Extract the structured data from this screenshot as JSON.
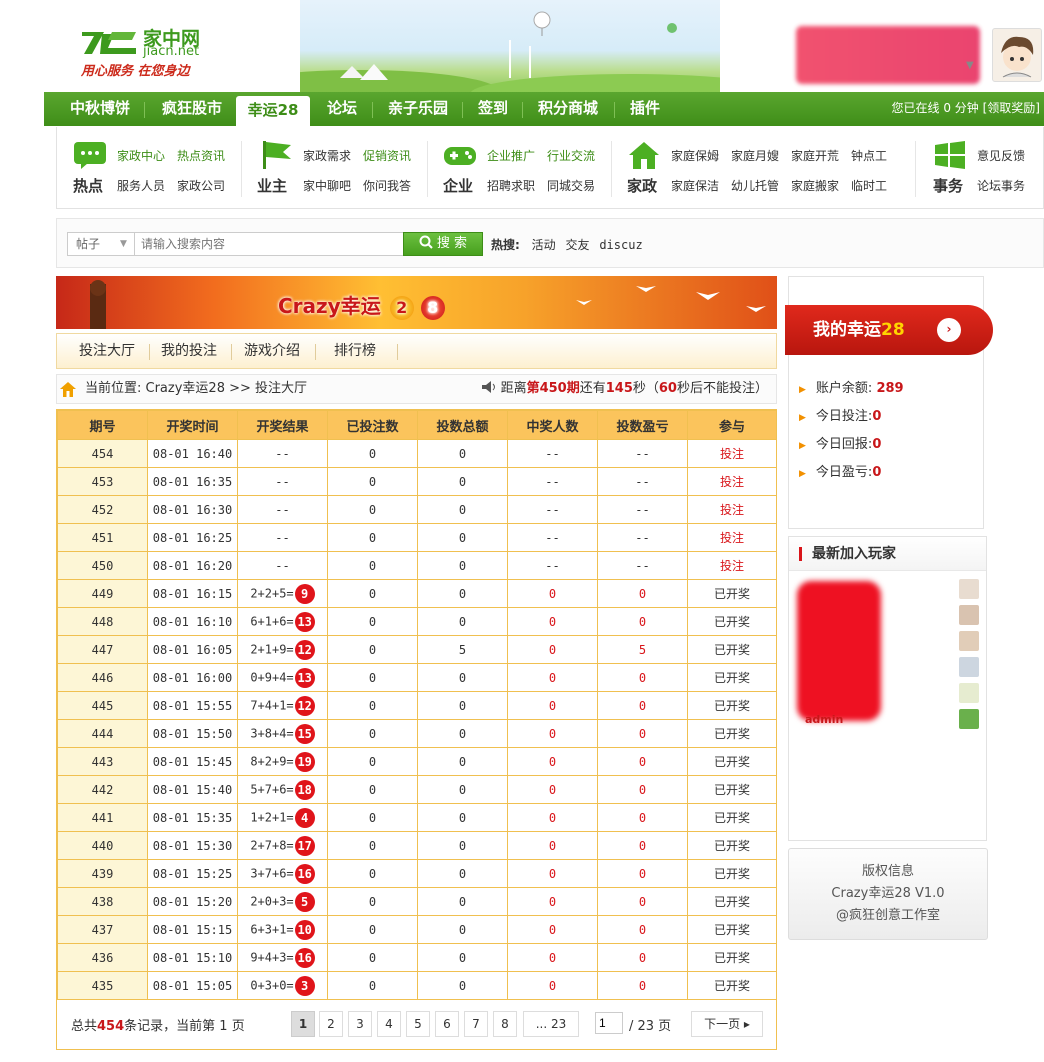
{
  "header": {
    "logo_name": "家中网",
    "logo_domain": "jiacn.net",
    "logo_slogan": "用心服务  在您身边"
  },
  "nav": {
    "items": [
      "中秋博饼",
      "疯狂股市",
      "幸运28",
      "论坛",
      "亲子乐园",
      "签到",
      "积分商城",
      "插件"
    ],
    "active": "幸运28",
    "online_text": "您已在线 0 分钟 [领取奖励]"
  },
  "categories": [
    {
      "title": "热点",
      "links": [
        "家政中心",
        "热点资讯",
        "服务人员",
        "家政公司"
      ]
    },
    {
      "title": "业主",
      "links": [
        "家政需求",
        "促销资讯",
        "家中聊吧",
        "你问我答"
      ]
    },
    {
      "title": "企业",
      "links": [
        "企业推广",
        "行业交流",
        "招聘求职",
        "同城交易"
      ]
    },
    {
      "title": "家政",
      "links": [
        "家庭保姆",
        "家庭月嫂",
        "家庭开荒",
        "钟点工",
        "家庭保洁",
        "幼儿托管",
        "家庭搬家",
        "临时工"
      ]
    },
    {
      "title": "事务",
      "links": [
        "意见反馈",
        "论坛事务"
      ]
    }
  ],
  "search": {
    "type": "帖子",
    "placeholder": "请输入搜索内容",
    "button": "搜 索",
    "hot_label": "热搜:",
    "hot_words": [
      "活动",
      "交友",
      "discuz"
    ]
  },
  "banner": {
    "title": "Crazy幸运",
    "num1": "2",
    "num2": "8"
  },
  "tabs": [
    "投注大厅",
    "我的投注",
    "游戏介绍",
    "排行榜"
  ],
  "crumb": {
    "text": "当前位置: Crazy幸运28 >> 投注大厅",
    "count_pre": "距离",
    "period": "第450期",
    "count_mid": "还有",
    "seconds": "145",
    "count_mid2": "秒（",
    "lock_seconds": "60",
    "count_post": "秒后不能投注）"
  },
  "table": {
    "headers": [
      "期号",
      "开奖时间",
      "开奖结果",
      "已投注数",
      "投数总额",
      "中奖人数",
      "投数盈亏",
      "参与"
    ],
    "rows": [
      {
        "id": "454",
        "time": "08-01 16:40",
        "expr": "--",
        "ball": "",
        "bets": "0",
        "total": "0",
        "winners": "--",
        "pl": "--",
        "act": "投注"
      },
      {
        "id": "453",
        "time": "08-01 16:35",
        "expr": "--",
        "ball": "",
        "bets": "0",
        "total": "0",
        "winners": "--",
        "pl": "--",
        "act": "投注"
      },
      {
        "id": "452",
        "time": "08-01 16:30",
        "expr": "--",
        "ball": "",
        "bets": "0",
        "total": "0",
        "winners": "--",
        "pl": "--",
        "act": "投注"
      },
      {
        "id": "451",
        "time": "08-01 16:25",
        "expr": "--",
        "ball": "",
        "bets": "0",
        "total": "0",
        "winners": "--",
        "pl": "--",
        "act": "投注"
      },
      {
        "id": "450",
        "time": "08-01 16:20",
        "expr": "--",
        "ball": "",
        "bets": "0",
        "total": "0",
        "winners": "--",
        "pl": "--",
        "act": "投注"
      },
      {
        "id": "449",
        "time": "08-01 16:15",
        "expr": "2+2+5=",
        "ball": "9",
        "bets": "0",
        "total": "0",
        "winners": "0",
        "pl": "0",
        "act": "已开奖"
      },
      {
        "id": "448",
        "time": "08-01 16:10",
        "expr": "6+1+6=",
        "ball": "13",
        "bets": "0",
        "total": "0",
        "winners": "0",
        "pl": "0",
        "act": "已开奖"
      },
      {
        "id": "447",
        "time": "08-01 16:05",
        "expr": "2+1+9=",
        "ball": "12",
        "bets": "0",
        "total": "5",
        "winners": "0",
        "pl": "5",
        "act": "已开奖"
      },
      {
        "id": "446",
        "time": "08-01 16:00",
        "expr": "0+9+4=",
        "ball": "13",
        "bets": "0",
        "total": "0",
        "winners": "0",
        "pl": "0",
        "act": "已开奖"
      },
      {
        "id": "445",
        "time": "08-01 15:55",
        "expr": "7+4+1=",
        "ball": "12",
        "bets": "0",
        "total": "0",
        "winners": "0",
        "pl": "0",
        "act": "已开奖"
      },
      {
        "id": "444",
        "time": "08-01 15:50",
        "expr": "3+8+4=",
        "ball": "15",
        "bets": "0",
        "total": "0",
        "winners": "0",
        "pl": "0",
        "act": "已开奖"
      },
      {
        "id": "443",
        "time": "08-01 15:45",
        "expr": "8+2+9=",
        "ball": "19",
        "bets": "0",
        "total": "0",
        "winners": "0",
        "pl": "0",
        "act": "已开奖"
      },
      {
        "id": "442",
        "time": "08-01 15:40",
        "expr": "5+7+6=",
        "ball": "18",
        "bets": "0",
        "total": "0",
        "winners": "0",
        "pl": "0",
        "act": "已开奖"
      },
      {
        "id": "441",
        "time": "08-01 15:35",
        "expr": "1+2+1=",
        "ball": "4",
        "bets": "0",
        "total": "0",
        "winners": "0",
        "pl": "0",
        "act": "已开奖"
      },
      {
        "id": "440",
        "time": "08-01 15:30",
        "expr": "2+7+8=",
        "ball": "17",
        "bets": "0",
        "total": "0",
        "winners": "0",
        "pl": "0",
        "act": "已开奖"
      },
      {
        "id": "439",
        "time": "08-01 15:25",
        "expr": "3+7+6=",
        "ball": "16",
        "bets": "0",
        "total": "0",
        "winners": "0",
        "pl": "0",
        "act": "已开奖"
      },
      {
        "id": "438",
        "time": "08-01 15:20",
        "expr": "2+0+3=",
        "ball": "5",
        "bets": "0",
        "total": "0",
        "winners": "0",
        "pl": "0",
        "act": "已开奖"
      },
      {
        "id": "437",
        "time": "08-01 15:15",
        "expr": "6+3+1=",
        "ball": "10",
        "bets": "0",
        "total": "0",
        "winners": "0",
        "pl": "0",
        "act": "已开奖"
      },
      {
        "id": "436",
        "time": "08-01 15:10",
        "expr": "9+4+3=",
        "ball": "16",
        "bets": "0",
        "total": "0",
        "winners": "0",
        "pl": "0",
        "act": "已开奖"
      },
      {
        "id": "435",
        "time": "08-01 15:05",
        "expr": "0+3+0=",
        "ball": "3",
        "bets": "0",
        "total": "0",
        "winners": "0",
        "pl": "0",
        "act": "已开奖"
      }
    ]
  },
  "pager": {
    "total_pre": "总共",
    "total_count": "454",
    "total_post": "条记录，当前第 1 页",
    "pages": [
      "1",
      "2",
      "3",
      "4",
      "5",
      "6",
      "7",
      "8",
      "... 23"
    ],
    "current": "1",
    "input_value": "1",
    "of_text": "/ 23 页",
    "next": "下一页 ▸"
  },
  "side": {
    "ribbon_label": "我的幸运",
    "ribbon_num": "28",
    "ribbon_go": "›",
    "account": [
      {
        "label": "账户余额:",
        "value": "289"
      },
      {
        "label": "今日投注:",
        "value": "0"
      },
      {
        "label": "今日回报:",
        "value": "0"
      },
      {
        "label": "今日盈亏:",
        "value": "0"
      }
    ],
    "players_title": "最新加入玩家",
    "player_visible": "admin",
    "copyright": [
      "版权信息",
      "Crazy幸运28 V1.0",
      "@疯狂创意工作室"
    ]
  }
}
